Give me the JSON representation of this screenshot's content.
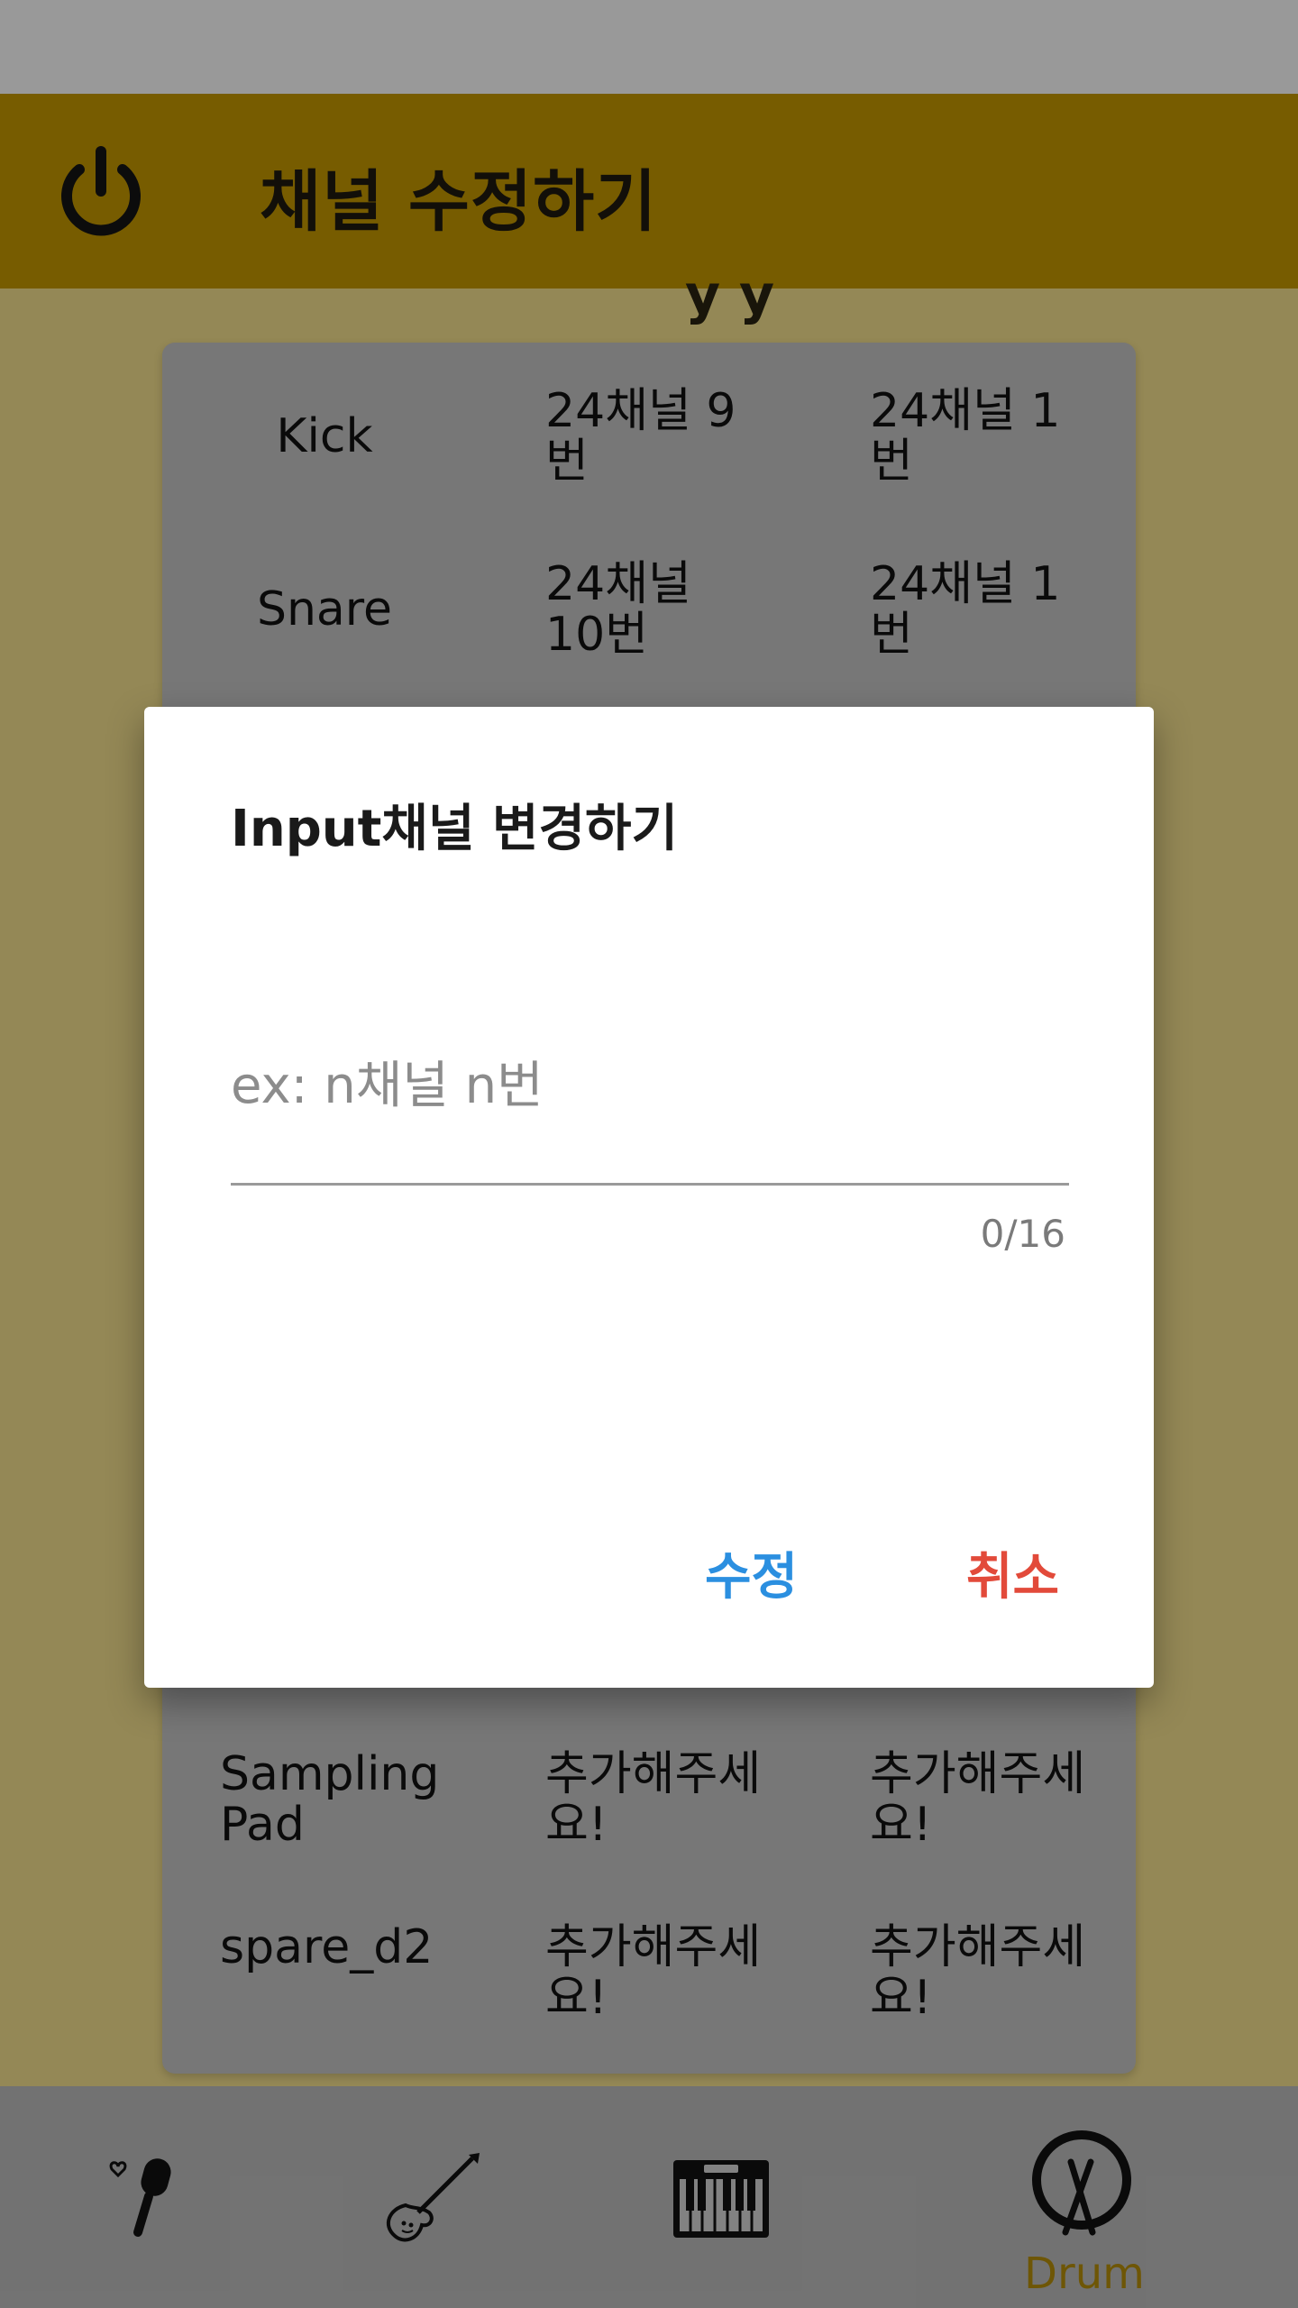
{
  "app_bar": {
    "title": "채널 수정하기",
    "icon": "power-icon"
  },
  "under_peek": "y y",
  "table": {
    "rows": [
      {
        "name": "Kick",
        "input": "24채널 9번",
        "output": "24채널 1번"
      },
      {
        "name": "Snare",
        "input": "24채널 10번",
        "output": "24채널 1번"
      },
      {
        "name": "",
        "input": "",
        "output": ""
      },
      {
        "name": "",
        "input": "",
        "output": ""
      },
      {
        "name": "",
        "input": "",
        "output": ""
      },
      {
        "name": "",
        "input": "",
        "output": ""
      },
      {
        "name": "",
        "input": "",
        "output": ""
      },
      {
        "name": "Sampling Pad",
        "input": "추가해주세요!",
        "output": "추가해주세요!"
      },
      {
        "name": "spare_d2",
        "input": "추가해주세요!",
        "output": "추가해주세요!"
      }
    ]
  },
  "dialog": {
    "title": "Input채널 변경하기",
    "input_value": "",
    "placeholder": "ex: n채널 n번",
    "counter": "0/16",
    "confirm_label": "수정",
    "cancel_label": "취소"
  },
  "bottom_nav": {
    "items": [
      {
        "icon": "microphone-icon"
      },
      {
        "icon": "guitar-icon"
      },
      {
        "icon": "piano-icon"
      },
      {
        "icon": "drum-icon",
        "label": "Drum",
        "active": true
      }
    ]
  },
  "colors": {
    "app_bar": "#c69a00",
    "content_bg": "#f7e38f",
    "card_bg": "#c6c6c6",
    "confirm": "#2b8fe0",
    "cancel": "#e24a3a",
    "active_nav": "#b8900a"
  }
}
